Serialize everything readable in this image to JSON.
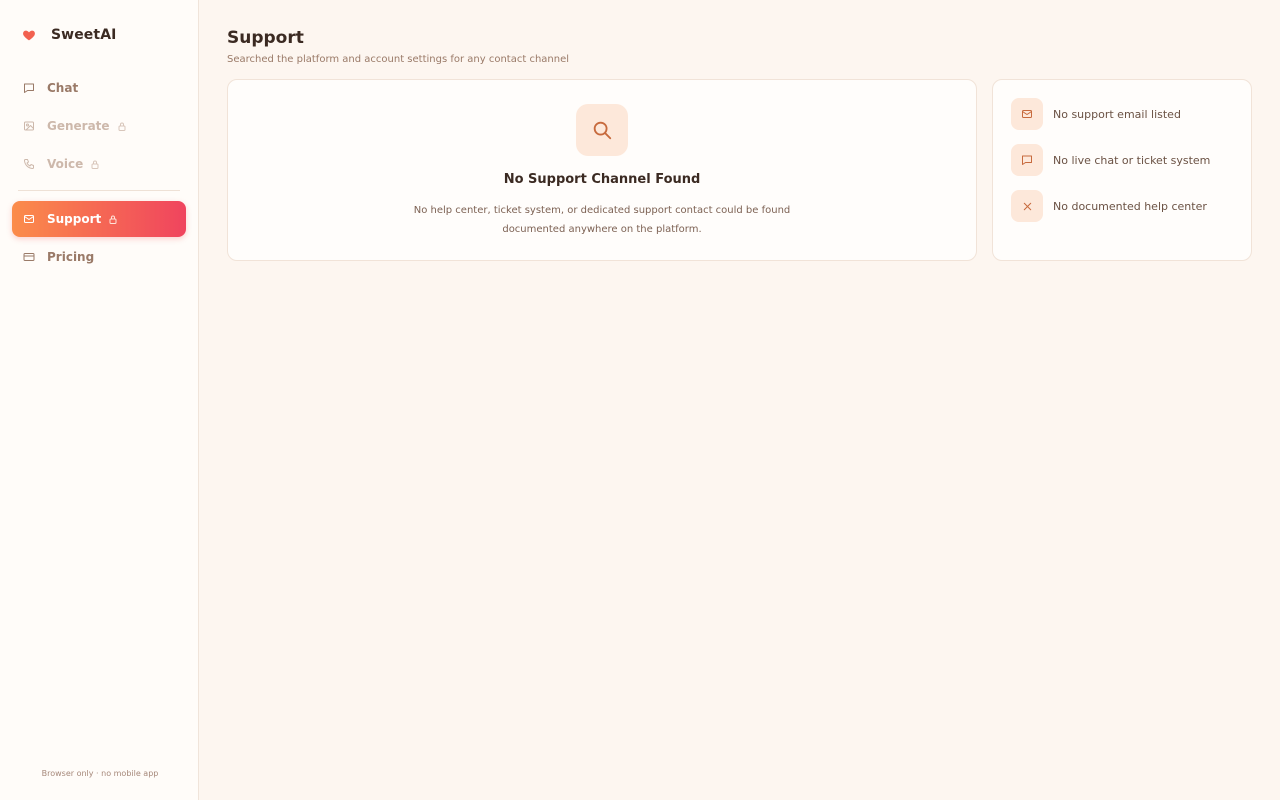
{
  "brand": {
    "name": "SweetAI"
  },
  "sidebar": {
    "items": [
      {
        "label": "Chat",
        "icon": "chat-icon",
        "state": "normal"
      },
      {
        "label": "Generate",
        "icon": "image-icon",
        "state": "locked"
      },
      {
        "label": "Voice",
        "icon": "phone-icon",
        "state": "locked"
      },
      {
        "label": "Support",
        "icon": "mail-icon",
        "state": "active"
      },
      {
        "label": "Pricing",
        "icon": "card-icon",
        "state": "normal"
      }
    ],
    "footer": "Browser only · no mobile app"
  },
  "page": {
    "title": "Support",
    "subtitle": "Searched the platform and account settings for any contact channel"
  },
  "main_card": {
    "icon": "search-icon",
    "title": "No Support Channel Found",
    "description": "No help center, ticket system, or dedicated support contact could be found documented anywhere on the platform."
  },
  "side_card": {
    "items": [
      {
        "label": "No support email listed",
        "icon": "mail-icon"
      },
      {
        "label": "No live chat or ticket system",
        "icon": "chat-icon"
      },
      {
        "label": "No documented help center",
        "icon": "x-icon"
      }
    ]
  },
  "colors": {
    "accent_start": "#fb8c4a",
    "accent_end": "#f0445e",
    "background": "#fdf6f0",
    "icon_tint": "#fde8da",
    "icon_stroke": "#c76a3d"
  }
}
